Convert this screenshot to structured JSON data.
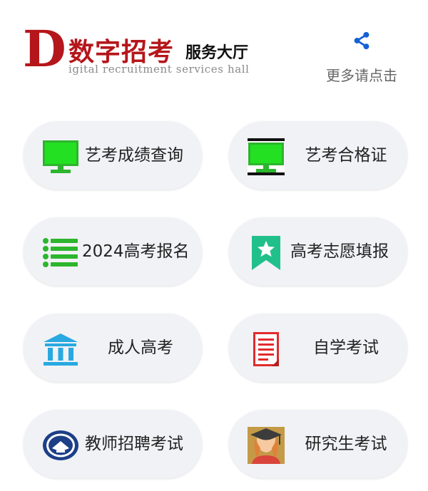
{
  "header": {
    "logo_letter": "D",
    "logo_title": "数字招考",
    "logo_subtitle": "服务大厅",
    "logo_tagline": "igital recruitment services hall",
    "share_icon": "share-icon",
    "share_label": "更多请点击",
    "brand_color": "#b5161b",
    "share_color": "#1560d6"
  },
  "tiles": [
    {
      "label": "艺考成绩查询",
      "icon": "monitor-icon"
    },
    {
      "label": "艺考合格证",
      "icon": "monitor-icon"
    },
    {
      "label": "2024高考报名",
      "icon": "list-icon"
    },
    {
      "label": "高考志愿填报",
      "icon": "bookmark-star-icon"
    },
    {
      "label": "成人高考",
      "icon": "building-icon"
    },
    {
      "label": "自学考试",
      "icon": "document-icon"
    },
    {
      "label": "教师招聘考试",
      "icon": "emblem-icon"
    },
    {
      "label": "研究生考试",
      "icon": "graduate-avatar-icon"
    }
  ]
}
